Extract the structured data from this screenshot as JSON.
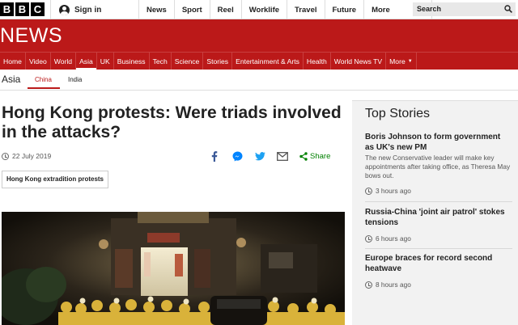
{
  "topbar": {
    "logo_letters": [
      "B",
      "B",
      "C"
    ],
    "signin_label": "Sign in",
    "nav": [
      "News",
      "Sport",
      "Reel",
      "Worklife",
      "Travel",
      "Future"
    ],
    "more_label": "More",
    "search_placeholder": "Search"
  },
  "header": {
    "title": "NEWS",
    "brand_color": "#bb1919",
    "nav": [
      "Home",
      "Video",
      "World",
      "Asia",
      "UK",
      "Business",
      "Tech",
      "Science",
      "Stories",
      "Entertainment & Arts",
      "Health",
      "World News TV",
      "More"
    ],
    "active": "Asia"
  },
  "subnav": {
    "section": "Asia",
    "items": [
      "China",
      "India"
    ],
    "active": "China"
  },
  "article": {
    "headline": "Hong Kong protests: Were triads involved in the attacks?",
    "date": "22 July 2019",
    "share_label": "Share",
    "share_icons": [
      "facebook-icon",
      "messenger-icon",
      "twitter-icon",
      "email-icon",
      "share-icon"
    ],
    "tag": "Hong Kong extradition protests"
  },
  "sidebar": {
    "title": "Top Stories",
    "stories": [
      {
        "headline": "Boris Johnson to form government as UK's new PM",
        "summary": "The new Conservative leader will make key appointments after taking office, as Theresa May bows out.",
        "time": "3 hours ago"
      },
      {
        "headline": "Russia-China 'joint air patrol' stokes tensions",
        "summary": "",
        "time": "6 hours ago"
      },
      {
        "headline": "Europe braces for record second heatwave",
        "summary": "",
        "time": "8 hours ago"
      }
    ]
  }
}
